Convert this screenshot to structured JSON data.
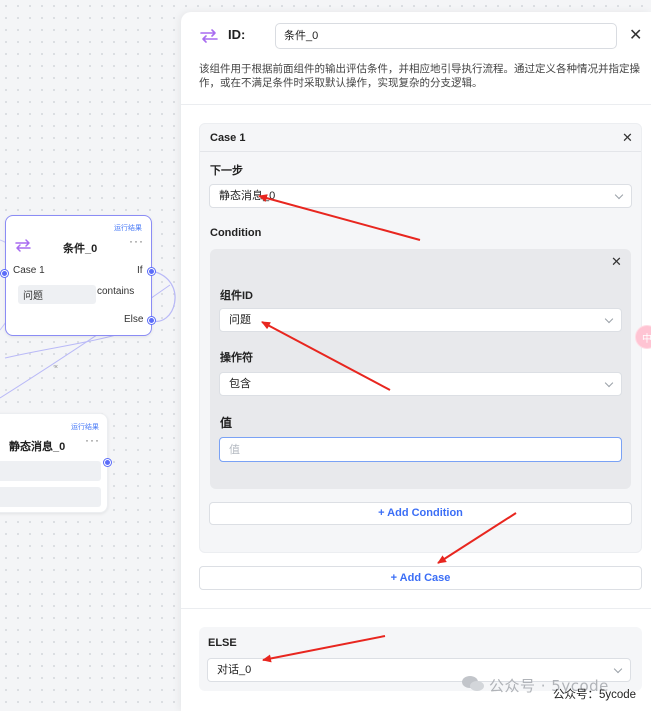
{
  "canvas": {
    "condition_node": {
      "run_link": "运行结果",
      "title": "条件_0",
      "case_label": "Case 1",
      "if_label": "If",
      "field_value": "问题",
      "operator": "contains",
      "else_label": "Else",
      "menu_icon": "more-dots-icon"
    },
    "message_node": {
      "run_link": "运行结果",
      "title": "静态消息_0",
      "menu_icon": "more-dots-icon"
    }
  },
  "panel": {
    "id_label": "ID:",
    "id_value": "条件_0",
    "description": "该组件用于根据前面组件的输出评估条件，并相应地引导执行流程。通过定义各种情况并指定操作，或在不满足条件时采取默认操作，实现复杂的分支逻辑。",
    "case": {
      "title": "Case 1",
      "next_step_label": "下一步",
      "next_step_value": "静态消息_0",
      "condition_label": "Condition",
      "component_id_label": "组件ID",
      "component_id_value": "问题",
      "operator_label": "操作符",
      "operator_value": "包含",
      "value_label": "值",
      "value_placeholder": "值",
      "add_condition_label": "+ Add Condition"
    },
    "add_case_label": "+ Add Case",
    "else": {
      "label": "ELSE",
      "value": "对话_0"
    }
  },
  "watermark": "公众号 · 5ycode",
  "credit": "公众号：5ycode",
  "colors": {
    "accent": "#3b6ef6",
    "node_border": "#8b8cf5",
    "port": "#5b6cf9",
    "arrow": "#e8261f",
    "icon": "#a86cf0"
  }
}
